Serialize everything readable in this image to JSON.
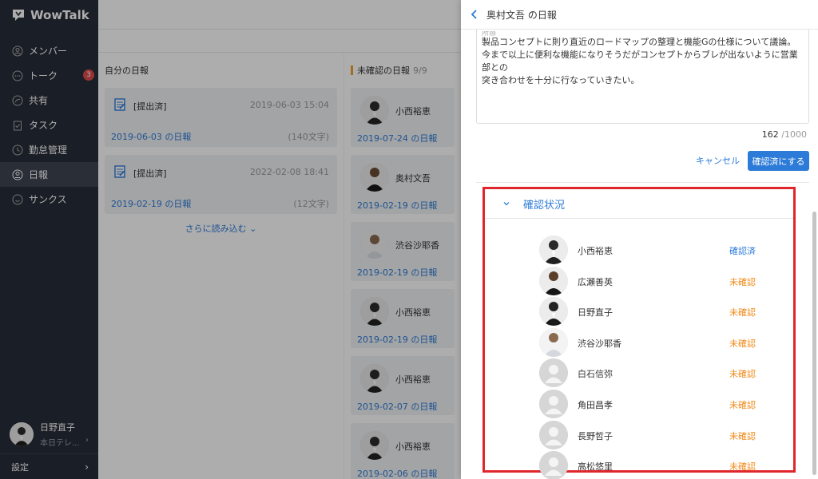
{
  "app": {
    "name": "WowTalk"
  },
  "sidebar": {
    "items": [
      {
        "label": "メンバー",
        "icon": "person-icon"
      },
      {
        "label": "トーク",
        "icon": "chat-icon",
        "badge": "3"
      },
      {
        "label": "共有",
        "icon": "share-icon"
      },
      {
        "label": "タスク",
        "icon": "clipboard-icon"
      },
      {
        "label": "勤怠管理",
        "icon": "clock-icon"
      },
      {
        "label": "日報",
        "icon": "report-icon",
        "active": true
      },
      {
        "label": "サンクス",
        "icon": "smile-icon"
      }
    ],
    "user": {
      "name": "日野直子",
      "sub": "本日テレ..."
    },
    "settings_label": "設定"
  },
  "left_column": {
    "header": "自分の日報",
    "cards": [
      {
        "status": "[提出済]",
        "date": "2019-06-03 15:04",
        "link": "2019-06-03 の日報",
        "chars": "(140文字)"
      },
      {
        "status": "[提出済]",
        "date": "2022-02-08 18:41",
        "link": "2019-02-19 の日報",
        "chars": "(12文字)"
      }
    ],
    "load_more": "さらに読み込む"
  },
  "mid_column": {
    "header": "未確認の日報",
    "count": "9/9",
    "cards": [
      {
        "name": "小西裕恵",
        "link": "2019-07-24 の日報"
      },
      {
        "name": "奥村文吾",
        "link": "2019-02-19 の日報"
      },
      {
        "name": "渋谷沙耶香",
        "link": "2019-02-19 の日報"
      },
      {
        "name": "小西裕恵",
        "link": "2019-02-19 の日報"
      },
      {
        "name": "小西裕恵",
        "link": "2019-02-07 の日報"
      },
      {
        "name": "小西裕恵",
        "link": "2019-02-06 の日報"
      }
    ]
  },
  "panel": {
    "title": "奥村文吾 の日報",
    "comment_lines": [
      "製品コンセプトに則り直近のロードマップの整理と機能Gの仕様について議論。",
      "今まで以上に便利な機能になりそうだがコンセプトからブレが出ないように営業部との",
      "突き合わせを十分に行なっていきたい。"
    ],
    "faded_label": "所感",
    "counter": {
      "current": "162",
      "max": "/1000"
    },
    "cancel_label": "キャンセル",
    "confirm_label": "確認済にする",
    "status_section": {
      "title": "確認状況",
      "members": [
        {
          "name": "小西裕恵",
          "status": "確認済",
          "state": "done",
          "photo": true
        },
        {
          "name": "広瀬善英",
          "status": "未確認",
          "state": "pending",
          "photo": true
        },
        {
          "name": "日野直子",
          "status": "未確認",
          "state": "pending",
          "photo": true
        },
        {
          "name": "渋谷沙耶香",
          "status": "未確認",
          "state": "pending",
          "photo": true
        },
        {
          "name": "白石信弥",
          "status": "未確認",
          "state": "pending",
          "photo": false
        },
        {
          "name": "角田昌孝",
          "status": "未確認",
          "state": "pending",
          "photo": false
        },
        {
          "name": "長野哲子",
          "status": "未確認",
          "state": "pending",
          "photo": false
        },
        {
          "name": "高松悠里",
          "status": "未確認",
          "state": "pending",
          "photo": false
        }
      ]
    }
  },
  "colors": {
    "sidebar_bg": "#272d38",
    "accent": "#2d7bd8",
    "pending": "#f08a18",
    "highlight": "#e0262d"
  }
}
